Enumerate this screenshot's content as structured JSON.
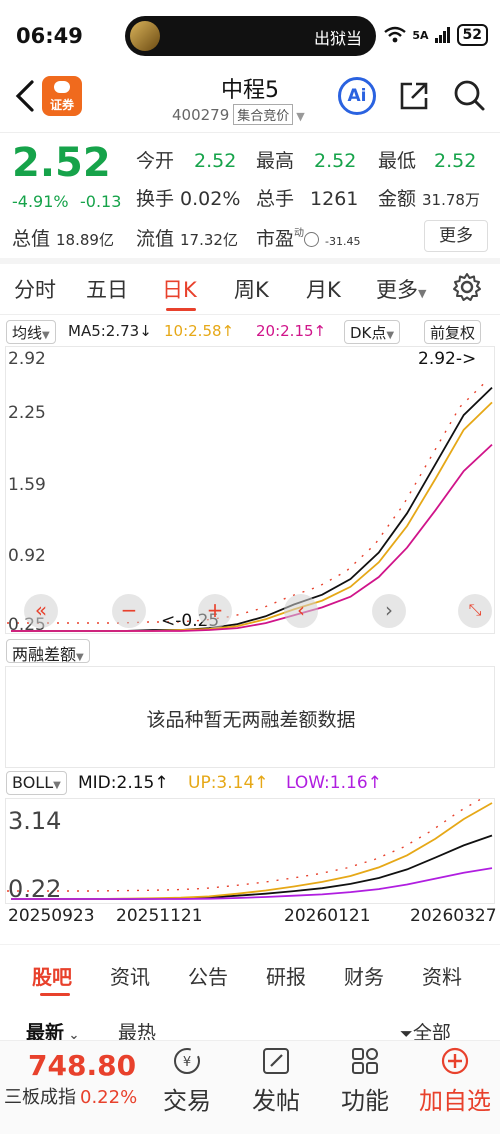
{
  "status": {
    "time": "06:49",
    "pill_text": "出狱当",
    "network": "5A",
    "battery": "52"
  },
  "header": {
    "title": "中程5",
    "code": "400279",
    "badge": "集合竞价",
    "broker_label": "证券",
    "ai_label": "Ai"
  },
  "quote": {
    "price": "2.52",
    "pct": "-4.91%",
    "change": "-0.13",
    "open_label": "今开",
    "open": "2.52",
    "high_label": "最高",
    "high": "2.52",
    "low_label": "最低",
    "low": "2.52",
    "turnover_label": "换手",
    "turnover": "0.02%",
    "volume_label": "总手",
    "volume": "1261",
    "amount_label": "金额",
    "amount": "31.78万",
    "mcap_label": "总值",
    "mcap": "18.89亿",
    "float_label": "流值",
    "float": "17.32亿",
    "pe_label": "市盈",
    "pe_dyn": "动",
    "pe": "-31.45",
    "more": "更多"
  },
  "period_tabs": [
    "分时",
    "五日",
    "日K",
    "周K",
    "月K",
    "更多"
  ],
  "active_period": "日K",
  "indicators": {
    "ma_chip": "均线",
    "ma5": "MA5:2.73↓",
    "ma10": "10:2.58↑",
    "ma20": "20:2.15↑",
    "dk_chip": "DK点",
    "adjust_chip": "前复权"
  },
  "kline": {
    "y_labels": [
      "2.92",
      "2.25",
      "1.59",
      "0.92",
      "0.25"
    ],
    "max_label": "2.92->",
    "min_label": "<-0.25"
  },
  "margin": {
    "chip": "两融差额",
    "message": "该品种暂无两融差额数据"
  },
  "boll": {
    "chip": "BOLL",
    "mid": "MID:2.15↑",
    "up": "UP:3.14↑",
    "low": "LOW:1.16↑",
    "y_top": "3.14",
    "y_bottom": "0.22"
  },
  "dates": [
    "20250923",
    "20251121",
    "20260121",
    "20260327"
  ],
  "section_tabs": [
    "股吧",
    "资讯",
    "公告",
    "研报",
    "财务",
    "资料"
  ],
  "sort": {
    "latest": "最新",
    "hot": "最热",
    "filter": "全部"
  },
  "bottom": {
    "index_price": "748.80",
    "index_name": "三板成指",
    "index_pct": "0.22%",
    "trade": "交易",
    "post": "发帖",
    "function": "功能",
    "add": "加自选"
  },
  "colors": {
    "up": "#e8412c",
    "down": "#16a34a",
    "ma5": "#111111",
    "ma10": "#e6a817",
    "ma20": "#d0148a"
  },
  "chart_data": [
    {
      "type": "line",
      "title": "",
      "ylim": [
        0.25,
        2.92
      ],
      "series": [
        {
          "name": "MA5",
          "values": [
            0.25,
            0.25,
            0.25,
            0.25,
            0.25,
            0.26,
            0.26,
            0.28,
            0.32,
            0.4,
            0.52,
            0.62,
            0.78,
            1.05,
            1.45,
            1.95,
            2.45,
            2.73
          ]
        },
        {
          "name": "10",
          "values": [
            0.25,
            0.25,
            0.25,
            0.25,
            0.25,
            0.25,
            0.26,
            0.27,
            0.3,
            0.37,
            0.47,
            0.56,
            0.7,
            0.95,
            1.32,
            1.8,
            2.3,
            2.58
          ]
        },
        {
          "name": "20",
          "values": [
            0.25,
            0.25,
            0.25,
            0.25,
            0.25,
            0.25,
            0.25,
            0.26,
            0.28,
            0.33,
            0.41,
            0.49,
            0.6,
            0.8,
            1.1,
            1.48,
            1.88,
            2.15
          ]
        }
      ]
    },
    {
      "type": "line",
      "title": "",
      "ylim": [
        0.22,
        3.14
      ],
      "series": [
        {
          "name": "MID",
          "values": [
            0.22,
            0.22,
            0.22,
            0.22,
            0.22,
            0.23,
            0.24,
            0.27,
            0.32,
            0.38,
            0.46,
            0.55,
            0.68,
            0.86,
            1.12,
            1.48,
            1.85,
            2.15
          ]
        },
        {
          "name": "UP",
          "values": [
            0.22,
            0.22,
            0.22,
            0.22,
            0.23,
            0.24,
            0.26,
            0.3,
            0.38,
            0.48,
            0.6,
            0.74,
            0.92,
            1.18,
            1.55,
            2.05,
            2.65,
            3.14
          ]
        },
        {
          "name": "LOW",
          "values": [
            0.22,
            0.22,
            0.22,
            0.22,
            0.22,
            0.22,
            0.22,
            0.23,
            0.25,
            0.28,
            0.32,
            0.36,
            0.43,
            0.52,
            0.66,
            0.84,
            1.02,
            1.16
          ]
        }
      ]
    }
  ]
}
